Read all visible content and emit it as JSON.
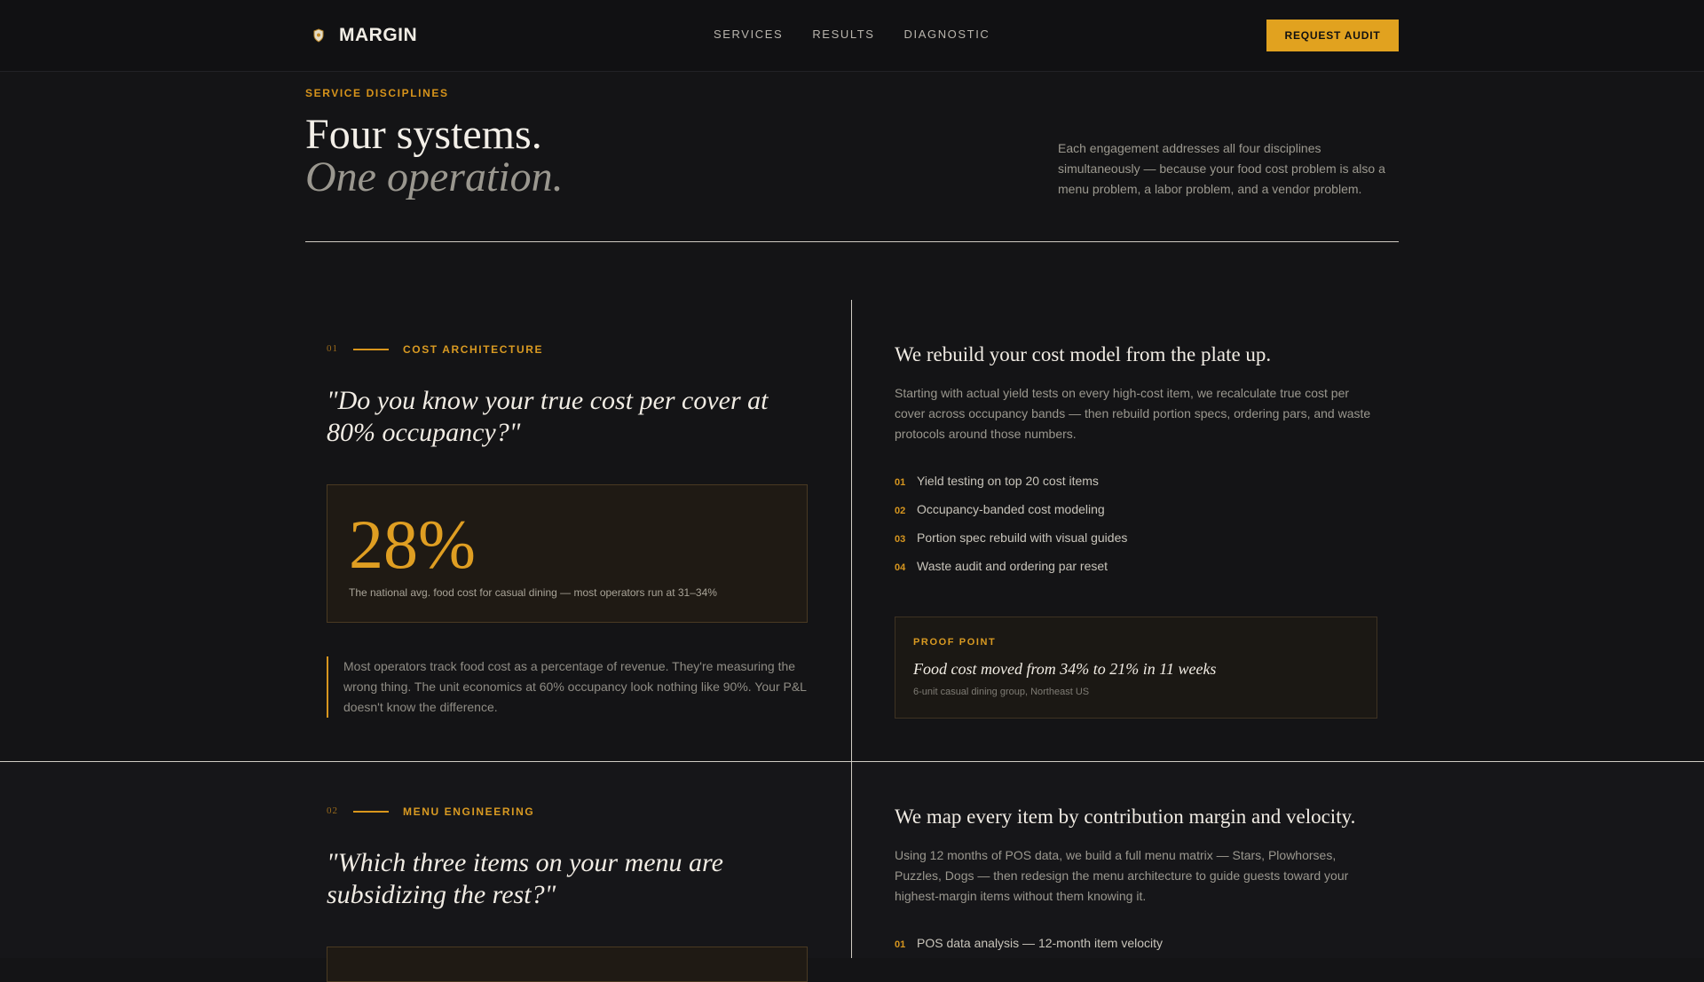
{
  "nav": {
    "brand": "MARGIN",
    "links": [
      "SERVICES",
      "RESULTS",
      "DIAGNOSTIC"
    ],
    "cta": "REQUEST AUDIT"
  },
  "header": {
    "eyebrow": "SERVICE DISCIPLINES",
    "title_line1": "Four systems.",
    "title_line2": "One operation.",
    "intro": "Each engagement addresses all four disciplines simultaneously — because your food cost problem is also a menu problem, a labor problem, and a vendor problem."
  },
  "sections": [
    {
      "num": "01",
      "label": "COST ARCHITECTURE",
      "quote": "\"Do you know your true cost per cover at 80% occupancy?\"",
      "stat": "28%",
      "stat_caption": "The national avg. food cost for casual dining — most operators run at 31–34%",
      "note": "Most operators track food cost as a percentage of revenue. They're measuring the wrong thing. The unit economics at 60% occupancy look nothing like 90%. Your P&L doesn't know the difference.",
      "heading": "We rebuild your cost model from the plate up.",
      "body": "Starting with actual yield tests on every high-cost item, we recalculate true cost per cover across occupancy bands — then rebuild portion specs, ordering pars, and waste protocols around those numbers.",
      "items": [
        {
          "n": "01",
          "t": "Yield testing on top 20 cost items"
        },
        {
          "n": "02",
          "t": "Occupancy-banded cost modeling"
        },
        {
          "n": "03",
          "t": "Portion spec rebuild with visual guides"
        },
        {
          "n": "04",
          "t": "Waste audit and ordering par reset"
        }
      ],
      "proof_label": "PROOF POINT",
      "proof_heading": "Food cost moved from 34% to 21% in 11 weeks",
      "proof_sub": "6-unit casual dining group, Northeast US"
    },
    {
      "num": "02",
      "label": "MENU ENGINEERING",
      "quote": "\"Which three items on your menu are subsidizing the rest?\"",
      "heading": "We map every item by contribution margin and velocity.",
      "body": "Using 12 months of POS data, we build a full menu matrix — Stars, Plowhorses, Puzzles, Dogs — then redesign the menu architecture to guide guests toward your highest-margin items without them knowing it.",
      "items": [
        {
          "n": "01",
          "t": "POS data analysis — 12-month item velocity"
        }
      ]
    }
  ]
}
